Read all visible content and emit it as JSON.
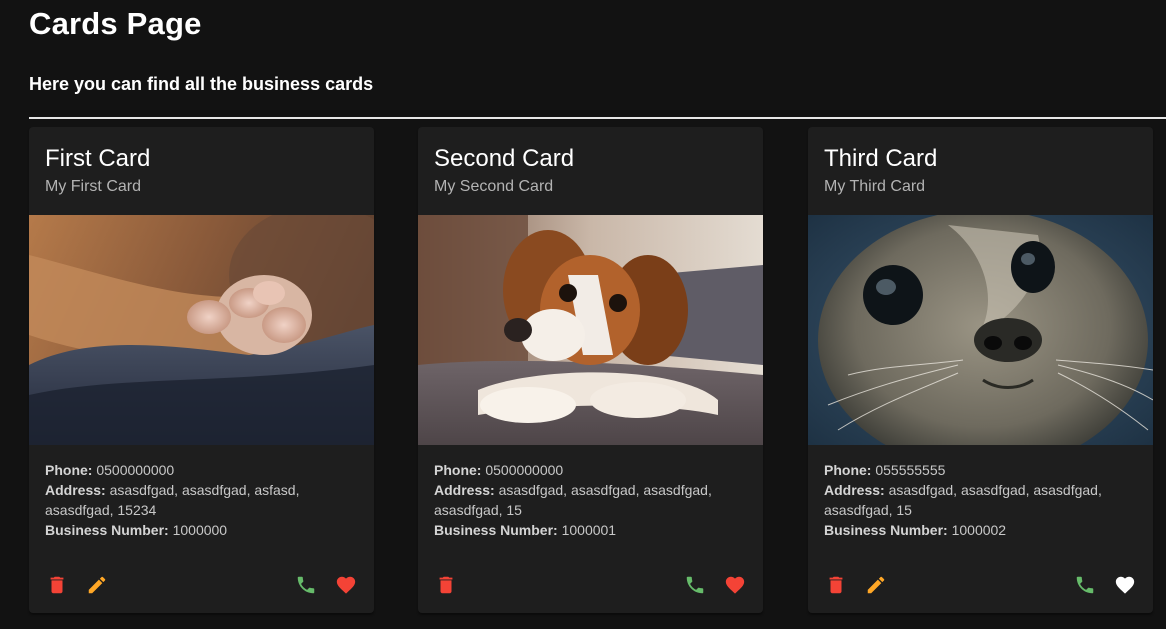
{
  "header": {
    "title": "Cards Page",
    "subtitle": "Here you can find all the business cards"
  },
  "labels": {
    "phone": "Phone:",
    "address": "Address:",
    "business_number": "Business Number:"
  },
  "colors": {
    "background": "#121212",
    "card_background": "#1e1e1e",
    "delete": "#f44336",
    "edit": "#ffa726",
    "phone": "#66bb6a",
    "favorite_active": "#f44336",
    "favorite_inactive": "#ffffff"
  },
  "cards": [
    {
      "title": "First Card",
      "subtitle": "My First Card",
      "image": "cat-paw-photo",
      "phone": "0500000000",
      "address": "asasdfgad, asasdfgad, asfasd, asasdfgad, 15234",
      "business_number": "1000000",
      "icons": [
        "delete-icon",
        "edit-icon",
        "phone-icon",
        "heart-icon"
      ],
      "favorite": true,
      "has_edit": true
    },
    {
      "title": "Second Card",
      "subtitle": "My Second Card",
      "image": "spaniel-dog-photo",
      "phone": "0500000000",
      "address": "asasdfgad, asasdfgad, asasdfgad, asasdfgad, 15",
      "business_number": "1000001",
      "icons": [
        "delete-icon",
        "phone-icon",
        "heart-icon"
      ],
      "favorite": true,
      "has_edit": false
    },
    {
      "title": "Third Card",
      "subtitle": "My Third Card",
      "image": "seal-photo",
      "phone": "055555555",
      "address": "asasdfgad, asasdfgad, asasdfgad, asasdfgad, 15",
      "business_number": "1000002",
      "icons": [
        "delete-icon",
        "edit-icon",
        "phone-icon",
        "heart-icon"
      ],
      "favorite": false,
      "has_edit": true
    }
  ]
}
